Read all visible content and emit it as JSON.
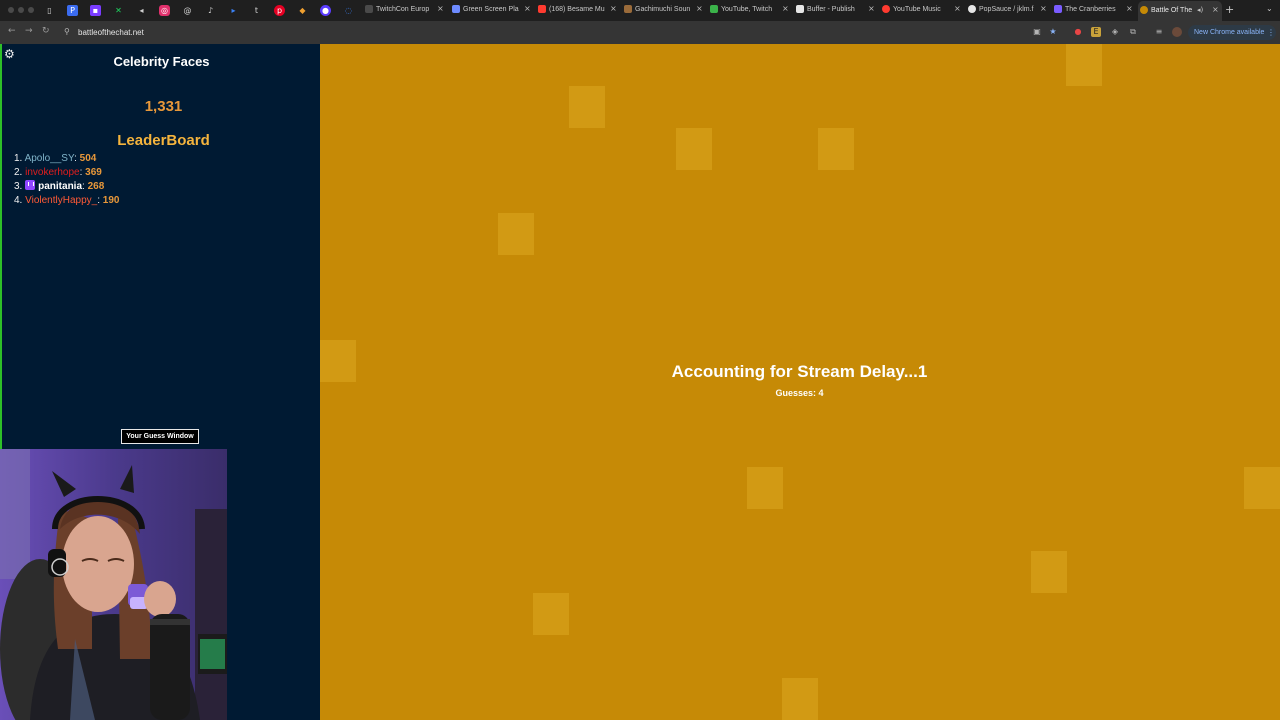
{
  "browser": {
    "tabs": [
      {
        "title": "TwitchCon Europ",
        "favicon_color": "#4a4a4a"
      },
      {
        "title": "Green Screen Pla",
        "favicon_color": "#6e8bff"
      },
      {
        "title": "(168) Besame Mu",
        "favicon_color": "#ff3b30"
      },
      {
        "title": "Gachimuchi Soun",
        "favicon_color": "#9a6b3a"
      },
      {
        "title": "YouTube, Twitch",
        "favicon_color": "#3bb34a"
      },
      {
        "title": "Buffer - Publish",
        "favicon_color": "#e6e6e6"
      },
      {
        "title": "YouTube Music",
        "favicon_color": "#ff3b30"
      },
      {
        "title": "PopSauce / jklm.f",
        "favicon_color": "#e6e6e6"
      },
      {
        "title": "The Cranberries",
        "favicon_color": "#7a5cff"
      },
      {
        "title": "Battle Of The",
        "favicon_color": "#c68a06"
      }
    ],
    "url": "battleofthechat.net",
    "update_label": "New Chrome available"
  },
  "game": {
    "category": "Celebrity Faces",
    "score": "1,331",
    "leaderboard_title": "LeaderBoard",
    "leaderboard": [
      {
        "rank": "1.",
        "name": "Apolo__SY",
        "points": "504",
        "color": "#7fb3c8",
        "badge": false
      },
      {
        "rank": "2.",
        "name": "invokerhope",
        "points": "369",
        "color": "#e01e1e",
        "badge": false
      },
      {
        "rank": "3.",
        "name": "panitania",
        "points": "268",
        "color": "#ffffff",
        "badge": true
      },
      {
        "rank": "4.",
        "name": "ViolentlyHappy_",
        "points": "190",
        "color": "#ff5a36",
        "badge": false
      }
    ],
    "guess_window_label": "Your Guess Window",
    "status": "Accounting for Stream Delay...1",
    "guesses": "Guesses: 4"
  },
  "colors": {
    "stage_bg": "#c68a06",
    "stage_square": "#d29a14",
    "panel_bg": "#001a33",
    "accent_orange": "#e8983a",
    "leaderboard_title": "#f5b43d",
    "green_accent": "#2ec028"
  },
  "icons": {
    "settings": "gear-icon",
    "profile_badge": "twitch-badge-icon"
  }
}
